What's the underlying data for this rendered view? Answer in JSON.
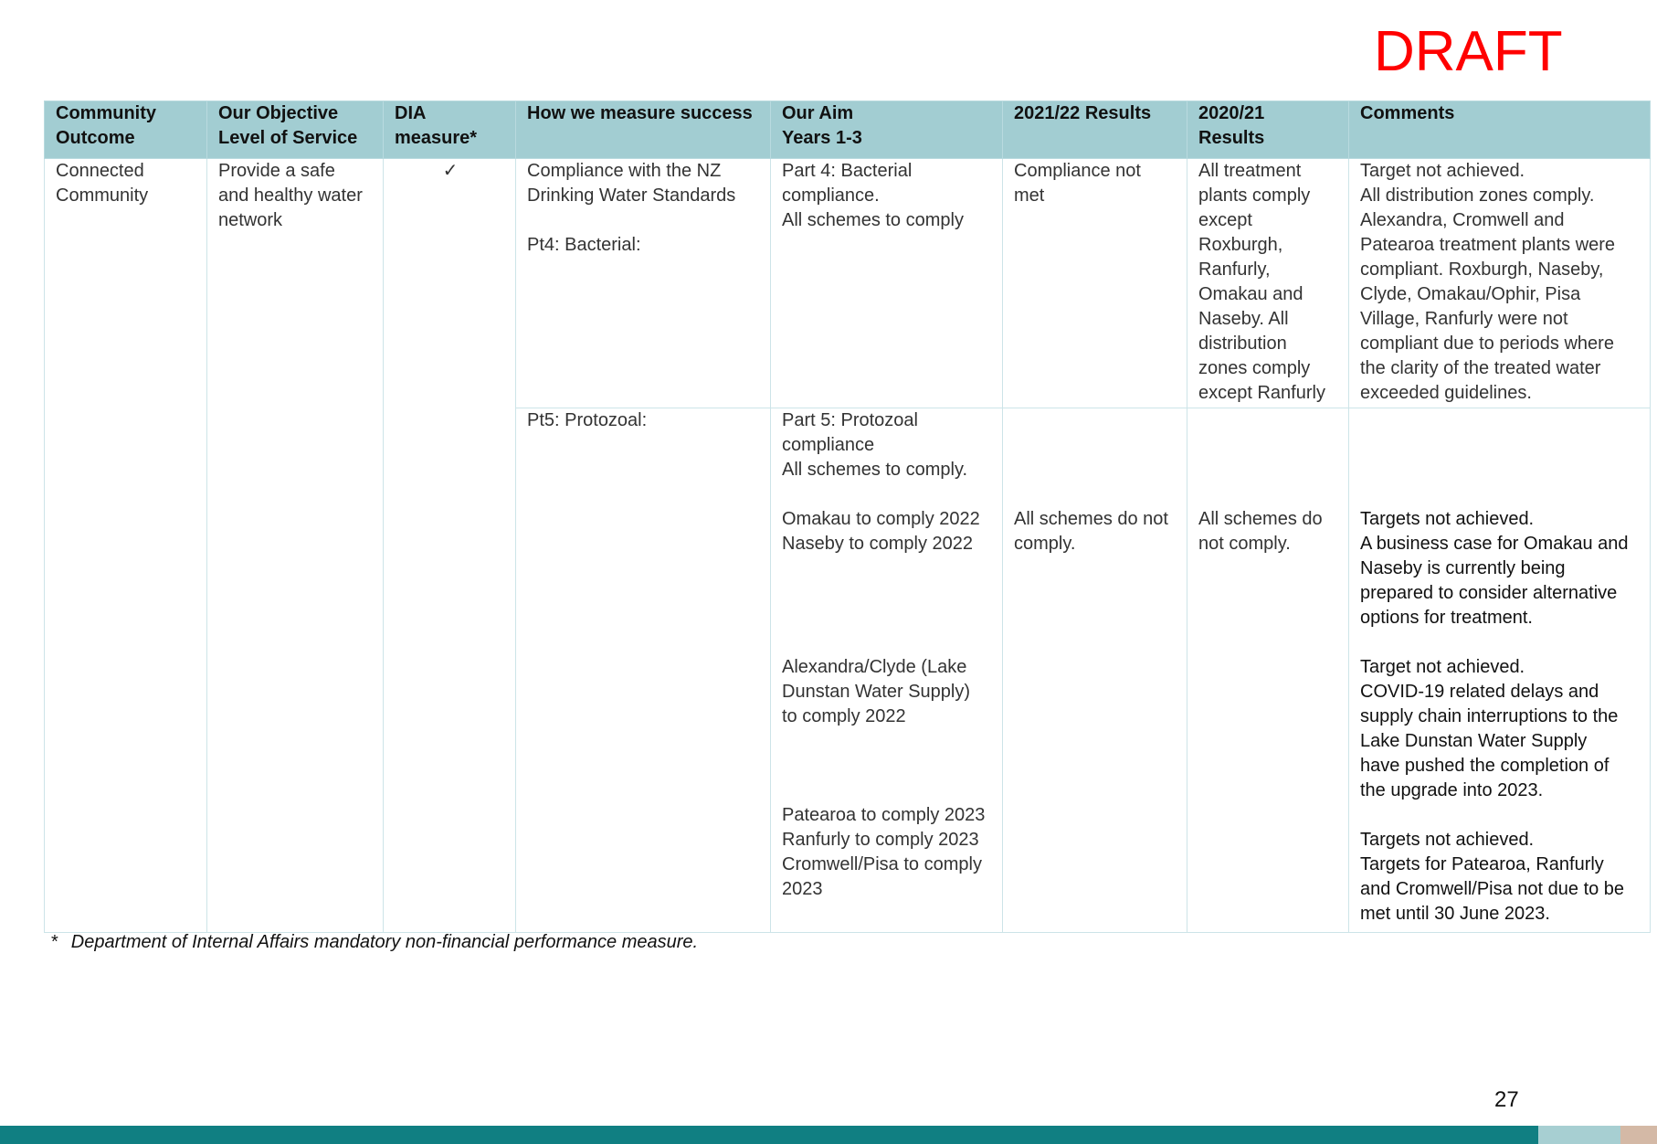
{
  "draft_label": "DRAFT",
  "table": {
    "headers": [
      "Community\nOutcome",
      "Our Objective\nLevel of Service",
      "DIA\nmeasure*",
      "How we measure success",
      "Our Aim\nYears 1-3",
      "2021/22 Results",
      "2020/21\nResults",
      "Comments"
    ],
    "row1": {
      "community_outcome": "Connected\nCommunity",
      "objective": "Provide a safe\nand healthy water\nnetwork",
      "dia_measure": "✓",
      "measure": "Compliance with the NZ\nDrinking Water Standards",
      "measure_sub": "Pt4: Bacterial:",
      "aim": "Part 4: Bacterial\ncompliance.\nAll schemes to comply",
      "result_2021_22": "Compliance not\nmet",
      "result_2020_21": "All treatment\nplants comply\nexcept\nRoxburgh,\nRanfurly,\nOmakau and\nNaseby.  All\ndistribution\nzones comply\nexcept Ranfurly",
      "comments": "Target not achieved.\nAll distribution zones comply.\nAlexandra, Cromwell and\nPatearoa treatment plants were\ncompliant. Roxburgh, Naseby,\nClyde, Omakau/Ophir, Pisa\nVillage, Ranfurly were not\ncompliant due to periods where\nthe clarity of the treated water\nexceeded guidelines."
    },
    "row2": {
      "measure": "Pt5: Protozoal:",
      "aim_intro": "Part 5: Protozoal\ncompliance\nAll schemes to comply.",
      "aim_omakau": "Omakau to comply 2022\nNaseby to comply 2022",
      "aim_alexandra": "Alexandra/Clyde (Lake\nDunstan Water Supply)\nto comply 2022",
      "aim_patearoa": "Patearoa to comply 2023\nRanfurly to comply 2023\nCromwell/Pisa to comply\n2023",
      "result_2021_22": "All schemes do not\ncomply.",
      "result_2020_21": "All schemes do\nnot comply.",
      "comment_omakau": "Targets not achieved.\nA business case for Omakau and\nNaseby is currently being\nprepared to consider alternative\noptions for treatment.",
      "comment_alexandra": "Target not achieved.\nCOVID-19 related delays and\nsupply chain interruptions to the\nLake Dunstan Water Supply\nhave pushed the completion of\nthe upgrade into 2023.",
      "comment_patearoa": "Targets not achieved.\nTargets for Patearoa, Ranfurly\nand Cromwell/Pisa not due to be\nmet until 30 June 2023."
    }
  },
  "footnote": {
    "marker": "*",
    "text": "Department of Internal Affairs mandatory non-financial performance measure."
  },
  "page_number": "27",
  "colors": {
    "header_bg": "#a2cdd2",
    "draft": "#ff0000",
    "bottom_bar": "#107f82"
  }
}
